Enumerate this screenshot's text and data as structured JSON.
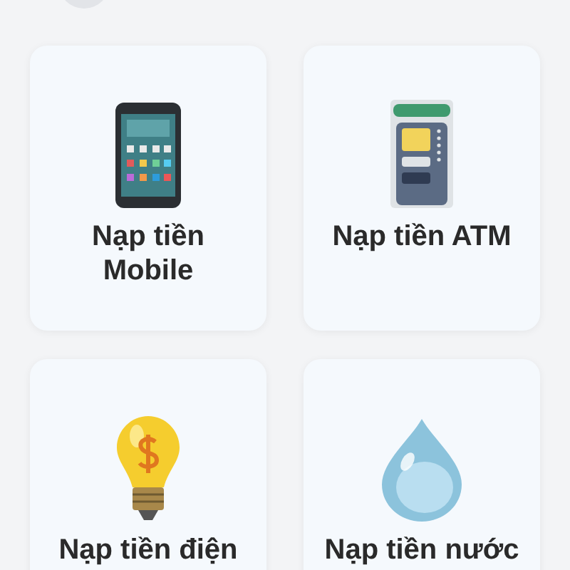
{
  "services": [
    {
      "kind": "phone",
      "label": "Nạp tiền Mobile"
    },
    {
      "kind": "atm",
      "label": "Nạp tiền ATM"
    },
    {
      "kind": "bulb",
      "label": "Nạp tiền điện"
    },
    {
      "kind": "drop",
      "label": "Nạp tiền nước"
    }
  ]
}
